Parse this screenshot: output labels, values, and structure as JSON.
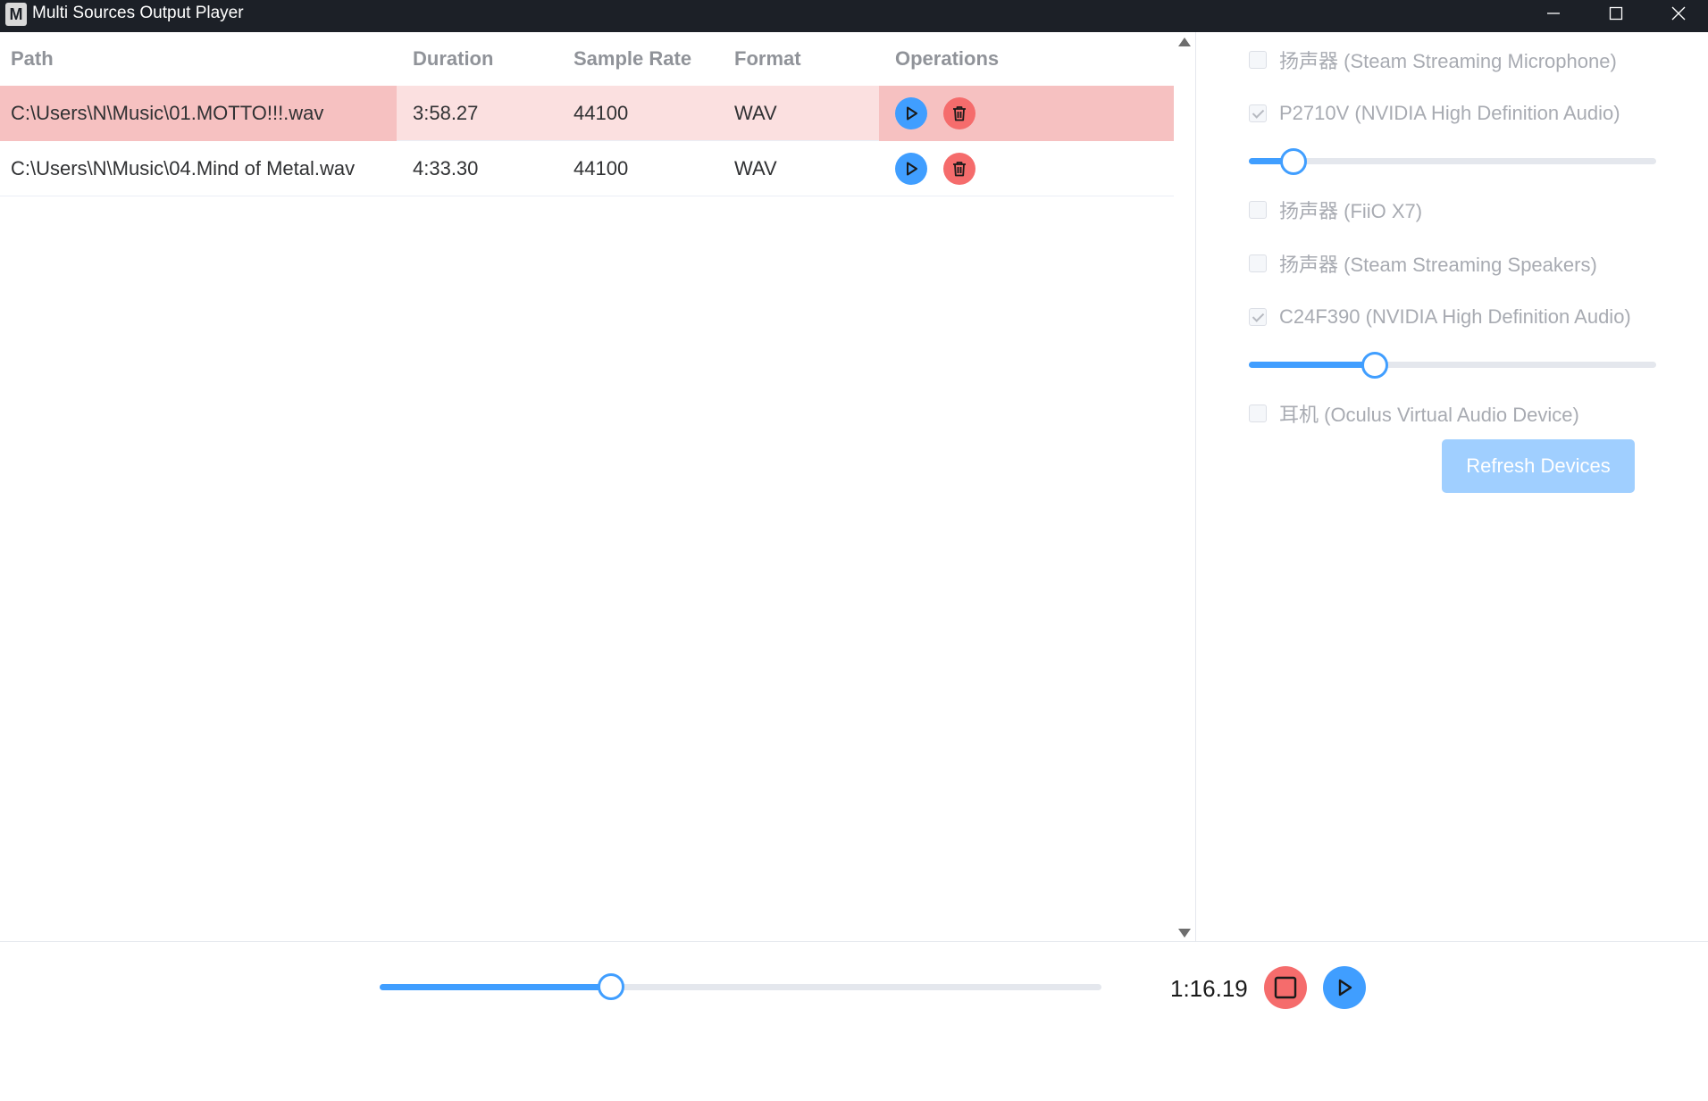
{
  "window": {
    "icon_letter": "M",
    "title": "Multi Sources Output Player"
  },
  "table": {
    "columns": {
      "path": "Path",
      "duration": "Duration",
      "sample_rate": "Sample Rate",
      "format": "Format",
      "operations": "Operations"
    },
    "rows": [
      {
        "path": "C:\\Users\\N\\Music\\01.MOTTO!!!.wav",
        "duration": "3:58.27",
        "sample_rate": "44100",
        "format": "WAV",
        "selected": true
      },
      {
        "path": "C:\\Users\\N\\Music\\04.Mind of Metal.wav",
        "duration": "4:33.30",
        "sample_rate": "44100",
        "format": "WAV",
        "selected": false
      }
    ]
  },
  "devices": {
    "items": [
      {
        "label": "扬声器 (Steam Streaming Microphone)",
        "checked": false
      },
      {
        "label": "P2710V (NVIDIA High Definition Audio)",
        "checked": true,
        "volume_fraction": 0.11
      },
      {
        "label": "扬声器 (FiiO X7)",
        "checked": false
      },
      {
        "label": "扬声器 (Steam Streaming Speakers)",
        "checked": false
      },
      {
        "label": "C24F390 (NVIDIA High Definition Audio)",
        "checked": true,
        "volume_fraction": 0.31
      },
      {
        "label": "耳机 (Oculus Virtual Audio Device)",
        "checked": false
      }
    ],
    "refresh_label": "Refresh Devices"
  },
  "player": {
    "current_time": "1:16.19",
    "progress_fraction": 0.32
  },
  "colors": {
    "accent": "#409eff",
    "danger": "#f56c6c",
    "selected_row": "#fbe0e0",
    "titlebar": "#1c2027"
  }
}
